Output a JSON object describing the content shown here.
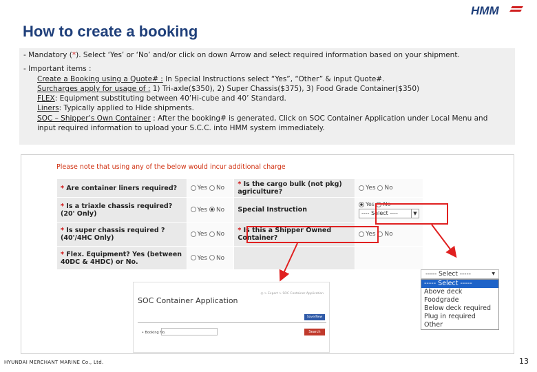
{
  "header": {
    "title": "How to create a booking",
    "logo_text": "HMM"
  },
  "info": {
    "mandatory_prefix": "-  Mandatory (",
    "mandatory_star": "*",
    "mandatory_suffix": ").  Select ‘Yes’ or ‘No’ and/or click on down Arrow and select required information based on your shipment.",
    "important_heading": "-  Important items :",
    "items": [
      {
        "term": "Create a Booking using a Quote# :",
        "text": " In Special Instructions select “Yes”, “Other” & input Quote#."
      },
      {
        "term": "Surcharges apply for usage of :",
        "text": " 1) Tri-axle($350), 2) Super Chassis($375), 3) Food Grade Container($350)"
      },
      {
        "term": "FLEX",
        "text": ": Equipment substituting between 40’Hi-cube and 40’ Standard."
      },
      {
        "term": "Liners",
        "text": ": Typically applied to Hide shipments."
      },
      {
        "term": "SOC – Shipper’s Own Container",
        "text": " : After the booking# is generated, Click on SOC Container Application under Local Menu and"
      }
    ],
    "soc_continuation": "input required information to upload your S.C.C. into HMM system immediately."
  },
  "form": {
    "notice": "Please note that using any of the below would incur additional charge",
    "yes": "Yes",
    "no": "No",
    "rows": [
      {
        "left_label": "Are container liners required?",
        "right_label": "Is the cargo bulk (not pkg) agriculture?"
      },
      {
        "left_label": "Is a triaxle chassis required? (20' Only)",
        "right_label": "Special Instruction"
      },
      {
        "left_label": "Is super chassis required ? (40'/4HC Only)",
        "right_label": "Is this a Shipper Owned Container?"
      },
      {
        "left_label": "Flex. Equipment? Yes (between 40DC & 4HDC) or No.",
        "right_label": ""
      }
    ],
    "special_select_value": "---- Select ----"
  },
  "soc_app": {
    "title": "SOC Container Application",
    "breadcrumb": "◎ > Export > SOC Container Application",
    "top_button": "Save/New",
    "booking_label": "• Booking No.",
    "search_button": "Search"
  },
  "dropdown": {
    "header": "----- Select -----",
    "options": [
      "----- Select -----",
      "Above deck",
      "Foodgrade",
      "Below deck required",
      "Plug in required",
      "Other"
    ],
    "selected_index": 0
  },
  "footer": {
    "company": "HYUNDAI MERCHANT MARINE Co., Ltd.",
    "page": "13"
  },
  "colors": {
    "title": "#1f3f7a",
    "accent_red": "#e02020",
    "select_highlight": "#1e63c8"
  }
}
